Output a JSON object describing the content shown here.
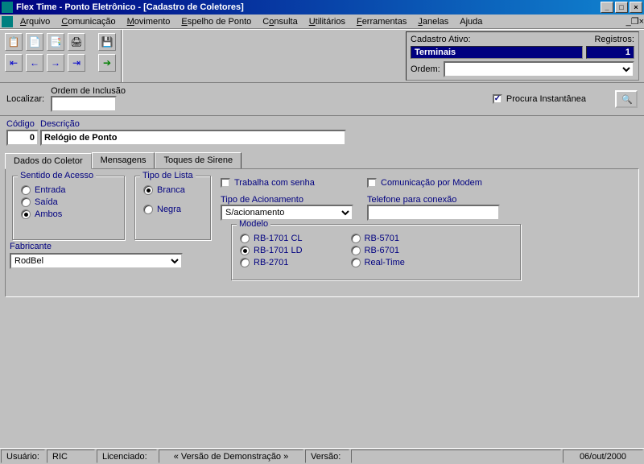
{
  "title": "Flex Time    -    Ponto Eletrônico - [Cadastro de Coletores]",
  "menu": [
    "Arquivo",
    "Comunicação",
    "Movimento",
    "Espelho de Ponto",
    "Consulta",
    "Utilitários",
    "Ferramentas",
    "Janelas",
    "Ajuda"
  ],
  "cad": {
    "ativo_label": "Cadastro Ativo:",
    "registros_label": "Registros:",
    "ativo_value": "Terminais",
    "registros_value": "1",
    "ordem_label": "Ordem:",
    "ordem_value": ""
  },
  "search": {
    "localizar_label": "Localizar:",
    "ordem_inclusao": "Ordem de Inclusão",
    "procura": "Procura Instantânea"
  },
  "codigo": {
    "codigo_label": "Código",
    "descricao_label": "Descrição",
    "codigo_value": "0",
    "descricao_value": "Relógio de Ponto"
  },
  "tabs": [
    "Dados do Coletor",
    "Mensagens",
    "Toques de Sirene"
  ],
  "sentido": {
    "legend": "Sentido de Acesso",
    "entrada": "Entrada",
    "saida": "Saída",
    "ambos": "Ambos"
  },
  "tipo_lista": {
    "legend": "Tipo de Lista",
    "branca": "Branca",
    "negra": "Negra"
  },
  "senha": {
    "check": "Trabalha com senha",
    "tipo_label": "Tipo de Acionamento",
    "tipo_value": "S/acionamento"
  },
  "modem": {
    "check": "Comunicação por Modem",
    "tel_label": "Telefone para conexão",
    "tel_value": ""
  },
  "modelo": {
    "legend": "Modelo",
    "opts": [
      "RB-1701 CL",
      "RB-1701 LD",
      "RB-2701",
      "RB-5701",
      "RB-6701",
      "Real-Time"
    ]
  },
  "fabricante": {
    "label": "Fabricante",
    "value": "RodBel"
  },
  "status": {
    "usuario_label": "Usuário:",
    "usuario": "RIC",
    "licenciado_label": "Licenciado:",
    "demo": "« Versão de Demonstração »",
    "versao_label": "Versão:",
    "data": "06/out/2000"
  }
}
